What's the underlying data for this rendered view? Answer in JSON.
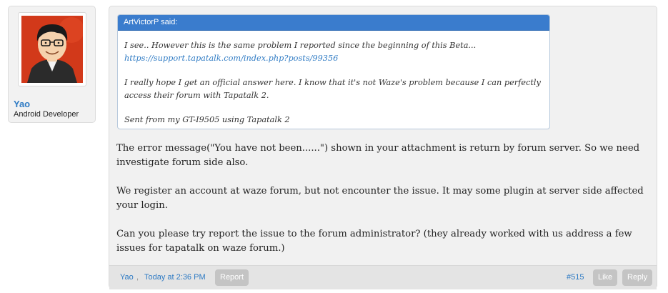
{
  "user": {
    "name": "Yao",
    "title": "Android Developer",
    "avatar_icon": "cartoon-avatar"
  },
  "quote": {
    "header": "ArtVictorP said:",
    "line1": "I see.. However this is the same problem I reported since the beginning of this Beta...",
    "link": "https://support.tapatalk.com/index.php?posts/99356",
    "line2": "I really hope I get an official answer here. I know that it's not Waze's problem because I can perfectly access their forum with Tapatalk 2.",
    "line3": "Sent from my GT-I9505 using Tapatalk 2"
  },
  "message": {
    "p1": "The error message(\"You have not been......\") shown in your attachment is return by forum server. So we need investigate forum side also.",
    "p2": "We register an account at waze forum, but not encounter the issue. It may some plugin at server side affected your login.",
    "p3": "Can you please try report the issue to the forum administrator? (they already worked with us address a few issues for tapatalk on waze forum.)"
  },
  "footer": {
    "author": "Yao",
    "separator": ",",
    "time": "Today at 2:36 PM",
    "report_label": "Report",
    "post_number": "#515",
    "like_label": "Like",
    "reply_label": "Reply"
  },
  "colors": {
    "link": "#2f7bc4",
    "quote_header_bg": "#3a7ccd",
    "button_bg": "#c4c4c4"
  }
}
